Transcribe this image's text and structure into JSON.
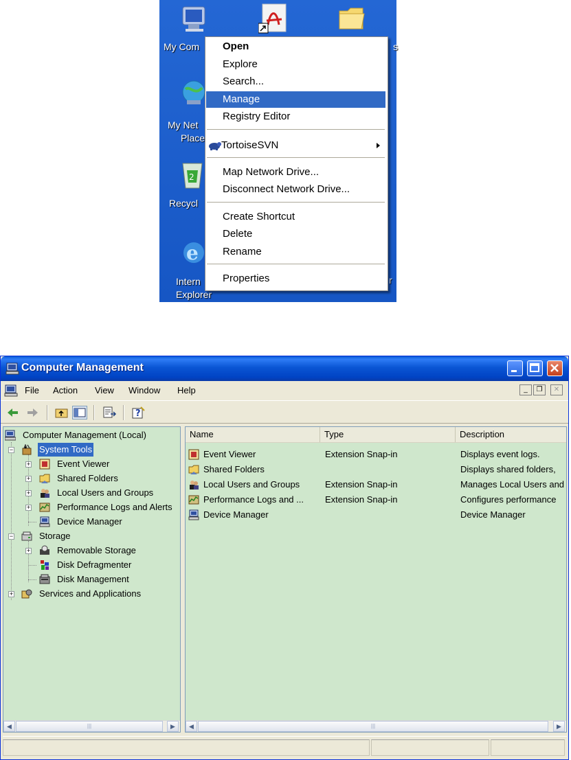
{
  "desktop": {
    "icons": [
      {
        "label": "My Com",
        "icon": "my-computer-icon"
      },
      {
        "label": "",
        "icon": "adobe-reader-shortcut-icon"
      },
      {
        "label": "",
        "icon": "folder-icon"
      },
      {
        "label": "My Net",
        "icon": "network-places-icon"
      },
      {
        "label": "Place",
        "icon": ""
      },
      {
        "label": "Recycl",
        "icon": "recycle-bin-icon"
      },
      {
        "label": "Intern",
        "icon": "internet-explorer-icon"
      },
      {
        "label": "Explorer",
        "icon": ""
      }
    ],
    "bg_color": "#1a5fcc"
  },
  "context_menu": {
    "items": [
      {
        "label": "Open"
      },
      {
        "label": "Explore"
      },
      {
        "label": "Search..."
      },
      {
        "label": "Manage",
        "highlighted": true
      },
      {
        "label": "Registry Editor"
      },
      {
        "label": "TortoiseSVN",
        "has_submenu": true,
        "icon": "tortoisesvn-icon"
      },
      {
        "label": "Map Network Drive..."
      },
      {
        "label": "Disconnect Network Drive..."
      },
      {
        "label": "Create Shortcut"
      },
      {
        "label": "Delete"
      },
      {
        "label": "Rename"
      },
      {
        "label": "Properties"
      }
    ],
    "highlight_color": "#316ac5"
  },
  "window": {
    "title": "Computer Management",
    "menu": [
      "File",
      "Action",
      "View",
      "Window",
      "Help"
    ],
    "tree": [
      {
        "label": "Computer Management (Local)",
        "icon": "computer-management-icon"
      },
      {
        "label": "System Tools",
        "icon": "system-tools-icon",
        "selected": true
      },
      {
        "label": "Event Viewer",
        "icon": "event-viewer-icon"
      },
      {
        "label": "Shared Folders",
        "icon": "shared-folders-icon"
      },
      {
        "label": "Local Users and Groups",
        "icon": "users-groups-icon"
      },
      {
        "label": "Performance Logs and Alerts",
        "icon": "performance-logs-icon"
      },
      {
        "label": "Device Manager",
        "icon": "device-manager-icon"
      },
      {
        "label": "Storage",
        "icon": "storage-icon"
      },
      {
        "label": "Removable Storage",
        "icon": "removable-storage-icon"
      },
      {
        "label": "Disk Defragmenter",
        "icon": "disk-defragmenter-icon"
      },
      {
        "label": "Disk Management",
        "icon": "disk-management-icon"
      },
      {
        "label": "Services and Applications",
        "icon": "services-applications-icon"
      }
    ],
    "list": {
      "columns": [
        "Name",
        "Type",
        "Description"
      ],
      "rows": [
        {
          "name": "Event Viewer",
          "type": "Extension Snap-in",
          "description": "Displays event logs."
        },
        {
          "name": "Shared Folders",
          "type": "",
          "description": "Displays shared folders,"
        },
        {
          "name": "Local Users and Groups",
          "type": "Extension Snap-in",
          "description": "Manages Local Users and"
        },
        {
          "name": "Performance Logs and ...",
          "type": "Extension Snap-in",
          "description": "Configures performance"
        },
        {
          "name": "Device Manager",
          "type": "",
          "description": "Device Manager"
        }
      ]
    },
    "pane_bg": "#cfe7cc",
    "title_bg": "#0a55d4"
  }
}
